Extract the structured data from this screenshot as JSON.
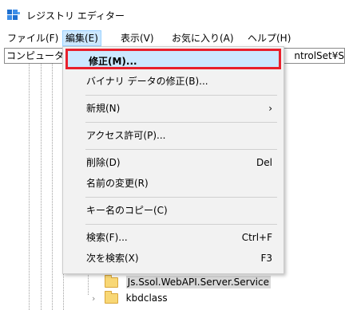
{
  "window": {
    "title": "レジストリ エディター"
  },
  "menubar": [
    {
      "label": "ファイル(F)"
    },
    {
      "label": "編集(E)"
    },
    {
      "label": "表示(V)"
    },
    {
      "label": "お気に入り(A)"
    },
    {
      "label": "ヘルプ(H)"
    }
  ],
  "address": {
    "left": "コンピューター",
    "right": "ntrolSet¥S"
  },
  "edit_menu": {
    "modify": "修正(M)...",
    "modify_binary": "バイナリ データの修正(B)...",
    "new": "新規(N)",
    "new_arrow": "›",
    "permissions": "アクセス許可(P)...",
    "delete": "削除(D)",
    "delete_shortcut": "Del",
    "rename": "名前の変更(R)",
    "copy_key_name": "キー名のコピー(C)",
    "find": "検索(F)...",
    "find_shortcut": "Ctrl+F",
    "find_next": "次を検索(X)",
    "find_next_shortcut": "F3"
  },
  "tree": [
    {
      "label": "Js.Ssol.WebAPI.Server.Service",
      "selected": true,
      "chevron": ""
    },
    {
      "label": "kbdclass",
      "selected": false,
      "chevron": "›"
    }
  ],
  "colors": {
    "highlight_border": "#e8202c",
    "hover_bg": "#cce8ff",
    "menu_bg": "#f2f2f2"
  }
}
